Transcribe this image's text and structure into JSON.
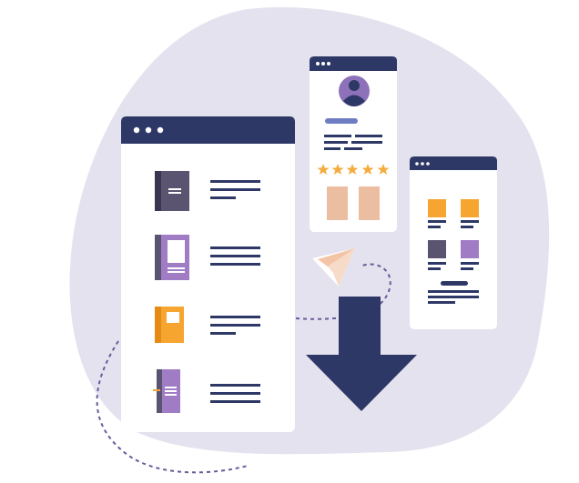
{
  "illustration": {
    "subject": "document-download-illustration",
    "colors": {
      "background_blob": "#e4e2ee",
      "navy": "#2e3866",
      "window_bg": "#ffffff",
      "gray_book": "#5a5470",
      "purple": "#a07cc5",
      "orange": "#f6a531",
      "peach": "#ecbea1",
      "star": "#f4ad40",
      "avatar_bg": "#8d72ba",
      "dashed": "#6b5a9a"
    },
    "main_window": {
      "dots": 3,
      "rows": [
        {
          "icon": "gray-book-icon"
        },
        {
          "icon": "purple-book-icon"
        },
        {
          "icon": "orange-notebook-icon"
        },
        {
          "icon": "purple-notebook-icon"
        }
      ]
    },
    "profile_window": {
      "dots": 3,
      "icon": "user-avatar-icon",
      "rating_stars": 5
    },
    "grid_window": {
      "dots": 3,
      "tiles": [
        "orange",
        "orange",
        "gray",
        "purple"
      ]
    },
    "decorations": [
      "paper-plane-icon",
      "download-arrow-icon",
      "dashed-path"
    ]
  }
}
